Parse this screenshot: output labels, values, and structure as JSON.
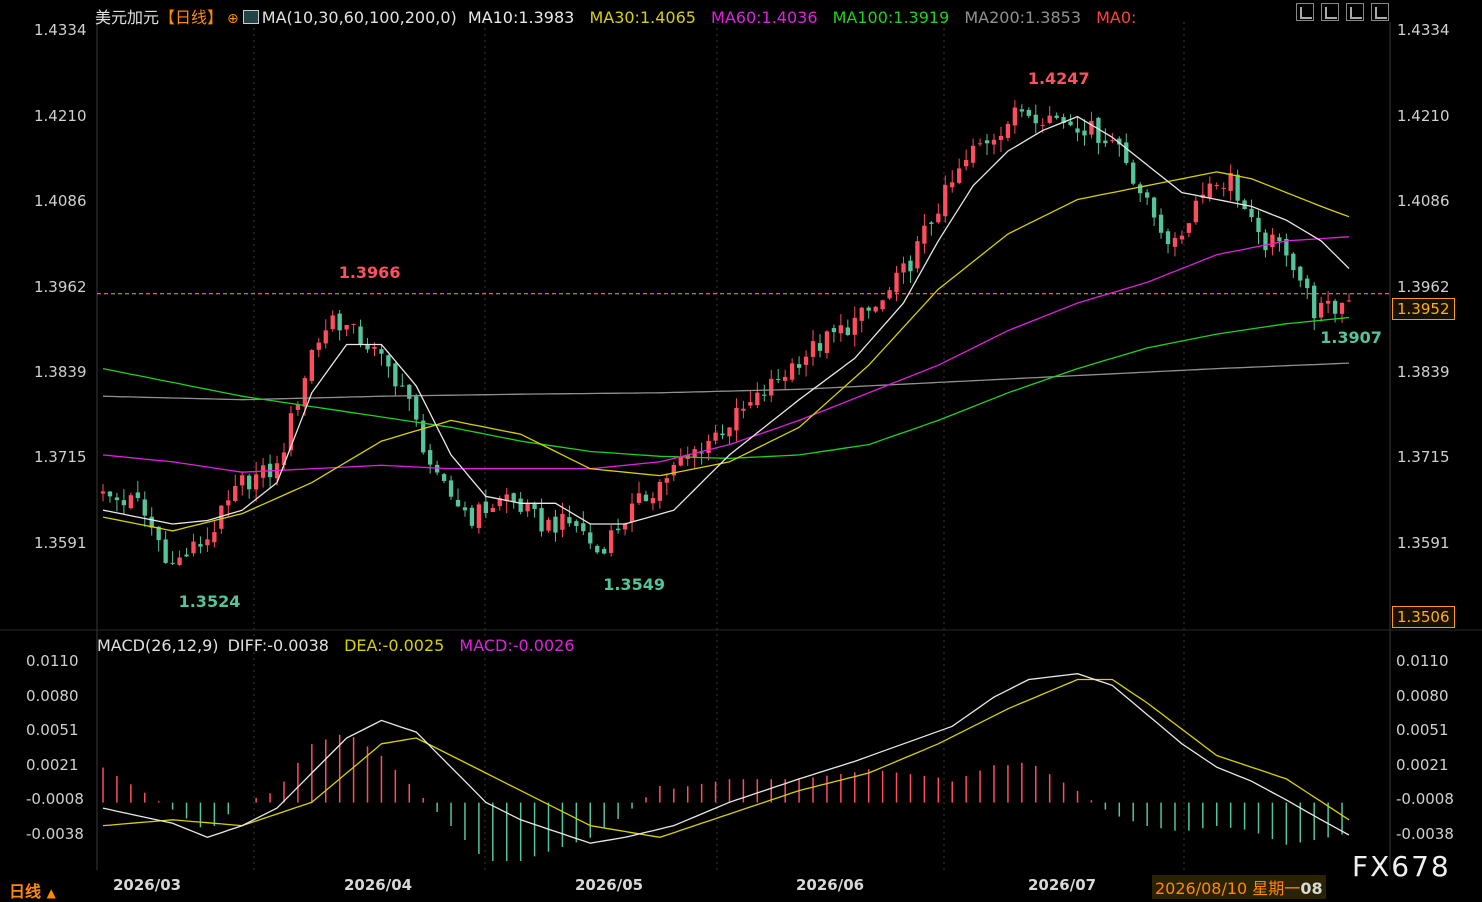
{
  "header": {
    "symbol": "美元加元",
    "period": "【日线】",
    "ma_params": "MA(10,30,60,100,200,0)",
    "ma10": "MA10:1.3983",
    "ma30": "MA30:1.4065",
    "ma60": "MA60:1.4036",
    "ma100": "MA100:1.3919",
    "ma200": "MA200:1.3853",
    "ma0": "MA0:"
  },
  "macd_header": {
    "params": "MACD(26,12,9)",
    "diff": "DIFF:-0.0038",
    "dea": "DEA:-0.0025",
    "macd": "MACD:-0.0026"
  },
  "footer": {
    "period_label": "日线",
    "cursor_date": "2026/08/10 星期一",
    "cursor_tail": "08",
    "watermark": "FX678"
  },
  "price_axis": {
    "ticks": [
      "1.4334",
      "1.4210",
      "1.4086",
      "1.3962",
      "1.3839",
      "1.3715",
      "1.3591"
    ],
    "current": "1.3952",
    "bottom": "1.3506"
  },
  "macd_axis": {
    "ticks": [
      "0.0110",
      "0.0080",
      "0.0051",
      "0.0021",
      "-0.0008",
      "-0.0038"
    ]
  },
  "dates": [
    "2026/03",
    "2026/04",
    "2026/05",
    "2026/06",
    "2026/07"
  ],
  "annotations": [
    {
      "label": "1.3966",
      "price": 1.3966,
      "idx": 33
    },
    {
      "label": "1.3524",
      "price": 1.3524,
      "idx": 10
    },
    {
      "label": "1.3549",
      "price": 1.3549,
      "idx": 71
    },
    {
      "label": "1.4247",
      "price": 1.4247,
      "idx": 132
    },
    {
      "label": "1.3907",
      "price": 1.3907,
      "idx": 174
    }
  ],
  "colors": {
    "up": "#ff4d5e",
    "down": "#54c49a",
    "ma10": "#e8e8e8",
    "ma30": "#d8d000",
    "ma60": "#e020e0",
    "ma100": "#20d020",
    "ma200": "#909090",
    "dea": "#d8d000",
    "diff": "#e8e8e8",
    "dash": "#ffa000"
  },
  "chart_data": {
    "type": "candlestick",
    "title": "美元加元【日线】",
    "ylim": [
      1.3506,
      1.4334
    ],
    "macd_ylim": [
      -0.0052,
      0.0115
    ],
    "count": 180,
    "close_path": [
      [
        0,
        1.366
      ],
      [
        5,
        1.365
      ],
      [
        10,
        1.356
      ],
      [
        15,
        1.36
      ],
      [
        20,
        1.368
      ],
      [
        25,
        1.37
      ],
      [
        30,
        1.387
      ],
      [
        33,
        1.392
      ],
      [
        38,
        1.388
      ],
      [
        43,
        1.382
      ],
      [
        48,
        1.368
      ],
      [
        53,
        1.363
      ],
      [
        58,
        1.366
      ],
      [
        63,
        1.362
      ],
      [
        68,
        1.362
      ],
      [
        71,
        1.358
      ],
      [
        76,
        1.364
      ],
      [
        82,
        1.37
      ],
      [
        88,
        1.375
      ],
      [
        94,
        1.38
      ],
      [
        100,
        1.386
      ],
      [
        106,
        1.39
      ],
      [
        112,
        1.394
      ],
      [
        116,
        1.4
      ],
      [
        120,
        1.408
      ],
      [
        125,
        1.416
      ],
      [
        132,
        1.422
      ],
      [
        140,
        1.42
      ],
      [
        146,
        1.417
      ],
      [
        150,
        1.408
      ],
      [
        154,
        1.402
      ],
      [
        158,
        1.411
      ],
      [
        162,
        1.412
      ],
      [
        166,
        1.403
      ],
      [
        170,
        1.402
      ],
      [
        174,
        1.393
      ],
      [
        177,
        1.393
      ],
      [
        179,
        1.3952
      ]
    ],
    "ma10": [
      [
        0,
        1.364
      ],
      [
        10,
        1.362
      ],
      [
        15,
        1.3625
      ],
      [
        20,
        1.364
      ],
      [
        25,
        1.368
      ],
      [
        30,
        1.381
      ],
      [
        35,
        1.388
      ],
      [
        40,
        1.388
      ],
      [
        45,
        1.382
      ],
      [
        50,
        1.372
      ],
      [
        55,
        1.366
      ],
      [
        60,
        1.365
      ],
      [
        65,
        1.365
      ],
      [
        70,
        1.362
      ],
      [
        75,
        1.362
      ],
      [
        82,
        1.364
      ],
      [
        90,
        1.372
      ],
      [
        100,
        1.38
      ],
      [
        108,
        1.386
      ],
      [
        115,
        1.394
      ],
      [
        120,
        1.403
      ],
      [
        125,
        1.411
      ],
      [
        130,
        1.416
      ],
      [
        135,
        1.419
      ],
      [
        140,
        1.421
      ],
      [
        145,
        1.418
      ],
      [
        150,
        1.414
      ],
      [
        155,
        1.41
      ],
      [
        160,
        1.409
      ],
      [
        165,
        1.408
      ],
      [
        170,
        1.406
      ],
      [
        175,
        1.403
      ],
      [
        179,
        1.399
      ]
    ],
    "ma30": [
      [
        0,
        1.363
      ],
      [
        10,
        1.361
      ],
      [
        20,
        1.3635
      ],
      [
        30,
        1.368
      ],
      [
        40,
        1.374
      ],
      [
        50,
        1.377
      ],
      [
        60,
        1.375
      ],
      [
        70,
        1.37
      ],
      [
        80,
        1.369
      ],
      [
        90,
        1.371
      ],
      [
        100,
        1.376
      ],
      [
        110,
        1.385
      ],
      [
        120,
        1.396
      ],
      [
        130,
        1.404
      ],
      [
        140,
        1.409
      ],
      [
        150,
        1.411
      ],
      [
        155,
        1.412
      ],
      [
        160,
        1.413
      ],
      [
        165,
        1.412
      ],
      [
        170,
        1.41
      ],
      [
        175,
        1.408
      ],
      [
        179,
        1.4065
      ]
    ],
    "ma60": [
      [
        0,
        1.372
      ],
      [
        10,
        1.371
      ],
      [
        20,
        1.3695
      ],
      [
        30,
        1.37
      ],
      [
        40,
        1.3705
      ],
      [
        50,
        1.37
      ],
      [
        60,
        1.37
      ],
      [
        70,
        1.37
      ],
      [
        80,
        1.371
      ],
      [
        90,
        1.3735
      ],
      [
        100,
        1.377
      ],
      [
        110,
        1.381
      ],
      [
        120,
        1.385
      ],
      [
        130,
        1.39
      ],
      [
        140,
        1.394
      ],
      [
        150,
        1.397
      ],
      [
        160,
        1.401
      ],
      [
        170,
        1.403
      ],
      [
        179,
        1.4036
      ]
    ],
    "ma100": [
      [
        0,
        1.3845
      ],
      [
        10,
        1.3825
      ],
      [
        20,
        1.3805
      ],
      [
        30,
        1.379
      ],
      [
        40,
        1.3775
      ],
      [
        50,
        1.376
      ],
      [
        60,
        1.374
      ],
      [
        70,
        1.3725
      ],
      [
        80,
        1.3718
      ],
      [
        90,
        1.3715
      ],
      [
        100,
        1.372
      ],
      [
        110,
        1.3735
      ],
      [
        120,
        1.377
      ],
      [
        130,
        1.381
      ],
      [
        140,
        1.3845
      ],
      [
        150,
        1.3875
      ],
      [
        160,
        1.3895
      ],
      [
        170,
        1.391
      ],
      [
        179,
        1.3919
      ]
    ],
    "ma200": [
      [
        0,
        1.3805
      ],
      [
        20,
        1.38
      ],
      [
        40,
        1.3805
      ],
      [
        60,
        1.3808
      ],
      [
        80,
        1.381
      ],
      [
        100,
        1.3815
      ],
      [
        120,
        1.3825
      ],
      [
        140,
        1.3835
      ],
      [
        160,
        1.3845
      ],
      [
        179,
        1.3853
      ]
    ],
    "diff": [
      [
        0,
        -0.0015
      ],
      [
        10,
        -0.0028
      ],
      [
        15,
        -0.004
      ],
      [
        20,
        -0.003
      ],
      [
        25,
        -0.0015
      ],
      [
        30,
        0.0015
      ],
      [
        35,
        0.0045
      ],
      [
        40,
        0.006
      ],
      [
        45,
        0.005
      ],
      [
        50,
        0.002
      ],
      [
        55,
        -0.001
      ],
      [
        60,
        -0.0025
      ],
      [
        65,
        -0.0035
      ],
      [
        70,
        -0.0045
      ],
      [
        75,
        -0.004
      ],
      [
        82,
        -0.003
      ],
      [
        90,
        -0.001
      ],
      [
        100,
        0.001
      ],
      [
        108,
        0.0025
      ],
      [
        115,
        0.004
      ],
      [
        122,
        0.0055
      ],
      [
        128,
        0.008
      ],
      [
        133,
        0.0095
      ],
      [
        140,
        0.01
      ],
      [
        145,
        0.009
      ],
      [
        150,
        0.0065
      ],
      [
        155,
        0.004
      ],
      [
        160,
        0.002
      ],
      [
        165,
        0.0008
      ],
      [
        170,
        -0.0008
      ],
      [
        175,
        -0.0025
      ],
      [
        179,
        -0.0038
      ]
    ],
    "dea": [
      [
        0,
        -0.003
      ],
      [
        10,
        -0.0025
      ],
      [
        20,
        -0.003
      ],
      [
        30,
        -0.001
      ],
      [
        40,
        0.004
      ],
      [
        45,
        0.0045
      ],
      [
        50,
        0.003
      ],
      [
        60,
        0.0
      ],
      [
        70,
        -0.003
      ],
      [
        80,
        -0.004
      ],
      [
        90,
        -0.002
      ],
      [
        100,
        0.0
      ],
      [
        110,
        0.0015
      ],
      [
        120,
        0.004
      ],
      [
        130,
        0.007
      ],
      [
        140,
        0.0095
      ],
      [
        145,
        0.0095
      ],
      [
        150,
        0.0075
      ],
      [
        160,
        0.003
      ],
      [
        170,
        0.001
      ],
      [
        179,
        -0.0025
      ]
    ]
  }
}
